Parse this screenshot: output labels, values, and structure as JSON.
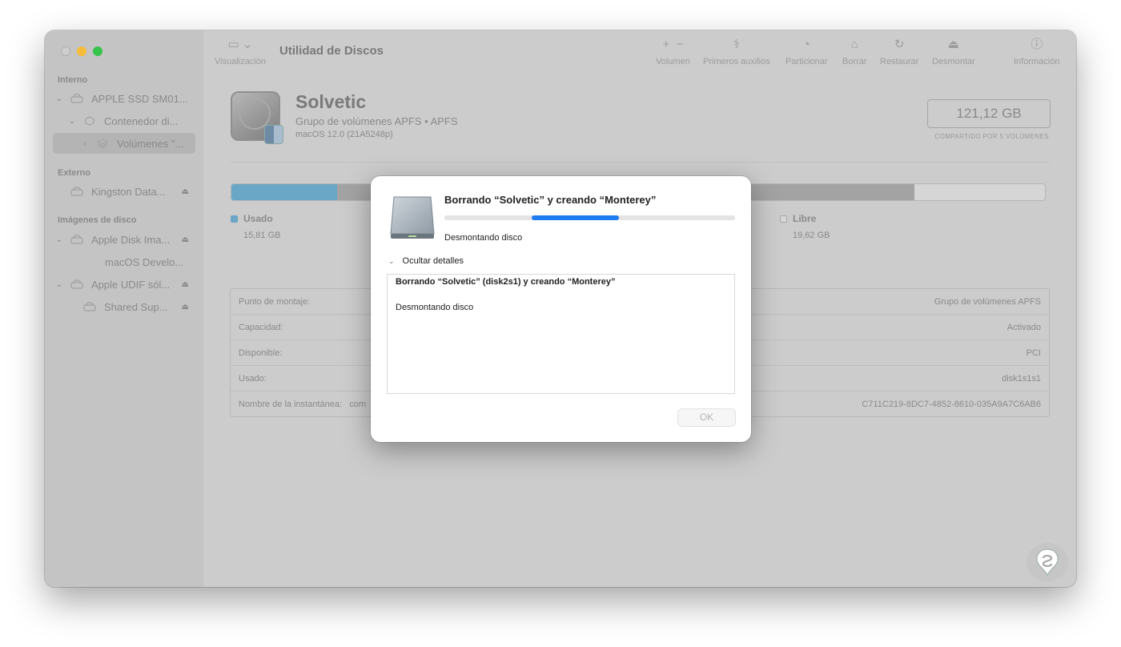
{
  "colors": {
    "used": "#6aa6c6",
    "other": "#a3a3a3",
    "progress": "#1f7cf0"
  },
  "sidebar": {
    "sections": [
      {
        "label": "Interno"
      },
      {
        "label": "Externo"
      },
      {
        "label": "Imágenes de disco"
      }
    ],
    "items": [
      {
        "label": "APPLE SSD SM01..."
      },
      {
        "label": "Contenedor di..."
      },
      {
        "label": "Volúmenes \"..."
      },
      {
        "label": "Kingston Data..."
      },
      {
        "label": "Apple Disk Ima..."
      },
      {
        "label": "macOS Develo..."
      },
      {
        "label": "Apple UDIF sól..."
      },
      {
        "label": "Shared Sup..."
      }
    ]
  },
  "toolbar": {
    "title": "Utilidad de Discos",
    "view_label": "Visualización",
    "volume_label": "Volumen",
    "first_aid_label": "Primeros auxilios",
    "partition_label": "Particionar",
    "erase_label": "Borrar",
    "restore_label": "Restaurar",
    "unmount_label": "Desmontar",
    "info_label": "Información"
  },
  "volume": {
    "name": "Solvetic",
    "subtitle": "Grupo de volúmenes APFS • APFS",
    "os": "macOS 12.0 (21A5248p)",
    "capacity": "121,12 GB",
    "capacity_note": "COMPARTIDO POR 5 VOLÚMENES"
  },
  "usage": {
    "used_fraction": 0.13,
    "other_fraction": 0.71,
    "used_label": "Usado",
    "used_value": "15,81 GB",
    "free_label": "Libre",
    "free_value": "19,62 GB"
  },
  "info": {
    "rows": [
      {
        "label": "Punto de montaje:",
        "value": "Grupo de volúmenes APFS"
      },
      {
        "label": "Capacidad:",
        "value": "Activado"
      },
      {
        "label": "Disponible:",
        "value": "PCI"
      },
      {
        "label": "Usado:",
        "value": "disk1s1s1"
      },
      {
        "label": "Nombre de la instantánea:",
        "label_tail": "com",
        "value": "C711C219-8DC7-4852-8610-035A9A7C6AB6"
      }
    ]
  },
  "dialog": {
    "title": "Borrando “Solvetic” y creando “Monterey”",
    "progress": 0.6,
    "status": "Desmontando disco",
    "details_toggle": "Ocultar detalles",
    "log_line1": "Borrando “Solvetic” (disk2s1) y creando “Monterey”",
    "log_line2": "Desmontando disco",
    "ok_label": "OK"
  }
}
